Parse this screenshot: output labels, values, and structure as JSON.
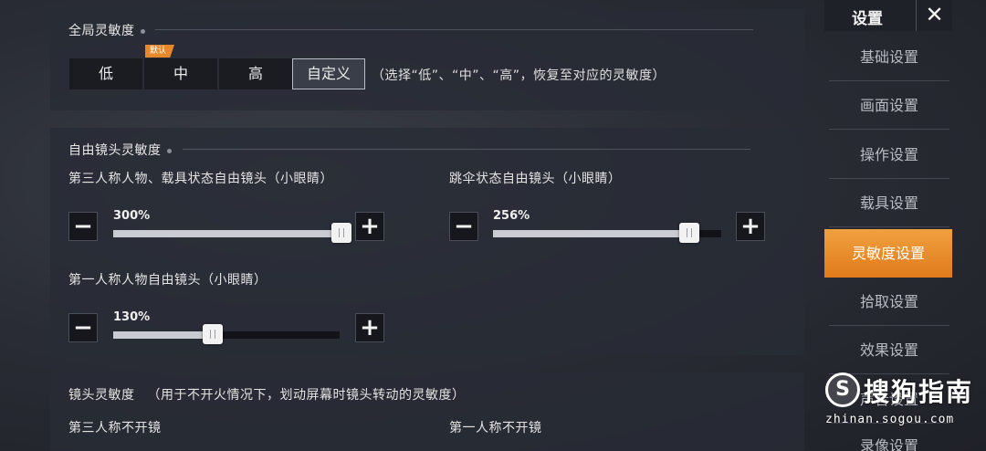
{
  "global": {
    "title": "全局灵敏度",
    "modes": [
      "低",
      "中",
      "高",
      "自定义"
    ],
    "selected_mode": "自定义",
    "default_tag": "默认",
    "hint": "（选择“低”、“中”、“高”，恢复至对应的灵敏度）"
  },
  "free_look": {
    "title": "自由镜头灵敏度",
    "sliders": [
      {
        "label": "第三人称人物、载具状态自由镜头（小眼睛）",
        "value_text": "300%",
        "fraction": 1.0
      },
      {
        "label": "跳伞状态自由镜头（小眼睛）",
        "value_text": "256%",
        "fraction": 0.86
      },
      {
        "label": "第一人称人物自由镜头（小眼睛）",
        "value_text": "130%",
        "fraction": 0.44
      }
    ],
    "minus_symbol": "−",
    "plus_symbol": "+"
  },
  "camera": {
    "title": "镜头灵敏度",
    "note": "（用于不开火情况下，划动屏幕时镜头转动的灵敏度）",
    "col_left": "第三人称不开镜",
    "col_right": "第一人称不开镜"
  },
  "sidebar": {
    "title": "设置",
    "close_symbol": "✕",
    "items": [
      "基础设置",
      "画面设置",
      "操作设置",
      "载具设置",
      "灵敏度设置",
      "拾取设置",
      "效果设置",
      "声音设置",
      "录像设置"
    ],
    "active_item": "灵敏度设置",
    "accent_color": "#e8892a"
  },
  "watermark": {
    "brand": "搜狗指南",
    "url": "zhinan.sogou.com"
  }
}
